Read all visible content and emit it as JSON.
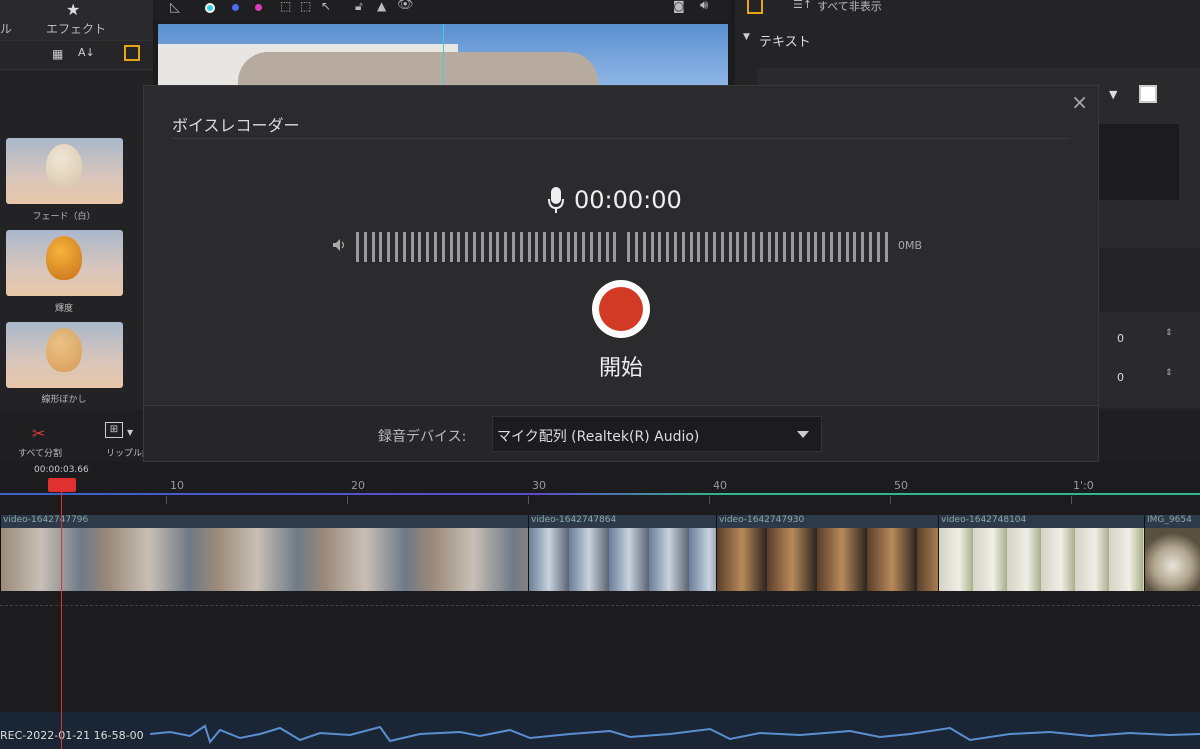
{
  "left_panel": {
    "tabs": [
      {
        "label": "ル"
      },
      {
        "label": "エフェクト"
      }
    ],
    "effects": [
      {
        "name": "フェード（白）"
      },
      {
        "name": "輝度"
      },
      {
        "name": "線形ぼかし"
      }
    ]
  },
  "right_panel": {
    "hide_all": "すべて非表示",
    "text_section": "テキスト",
    "values": [
      "0",
      "0"
    ]
  },
  "dialog": {
    "title": "ボイスレコーダー",
    "timer": "00:00:00",
    "size": "0MB",
    "start_label": "開始",
    "device_label": "録音デバイス:",
    "device_value": "マイク配列 (Realtek(R) Audio)"
  },
  "timeline_toolbar": {
    "split_all": "すべて分割",
    "ripple_edit": "リップル編集"
  },
  "ruler": {
    "playhead_time": "00:00:03.66",
    "ticks": [
      "10",
      "20",
      "30",
      "40",
      "50",
      "1':0"
    ]
  },
  "clips": [
    {
      "label": "video-1642747796"
    },
    {
      "label": "video-1642747864"
    },
    {
      "label": "video-1642747930"
    },
    {
      "label": "video-1642748104"
    },
    {
      "label": "IMG_9654"
    }
  ],
  "audio": {
    "label": "REC-2022-01-21 16-58-00"
  },
  "colors": {
    "accent_record": "#d23a26",
    "playhead": "#e03030"
  }
}
